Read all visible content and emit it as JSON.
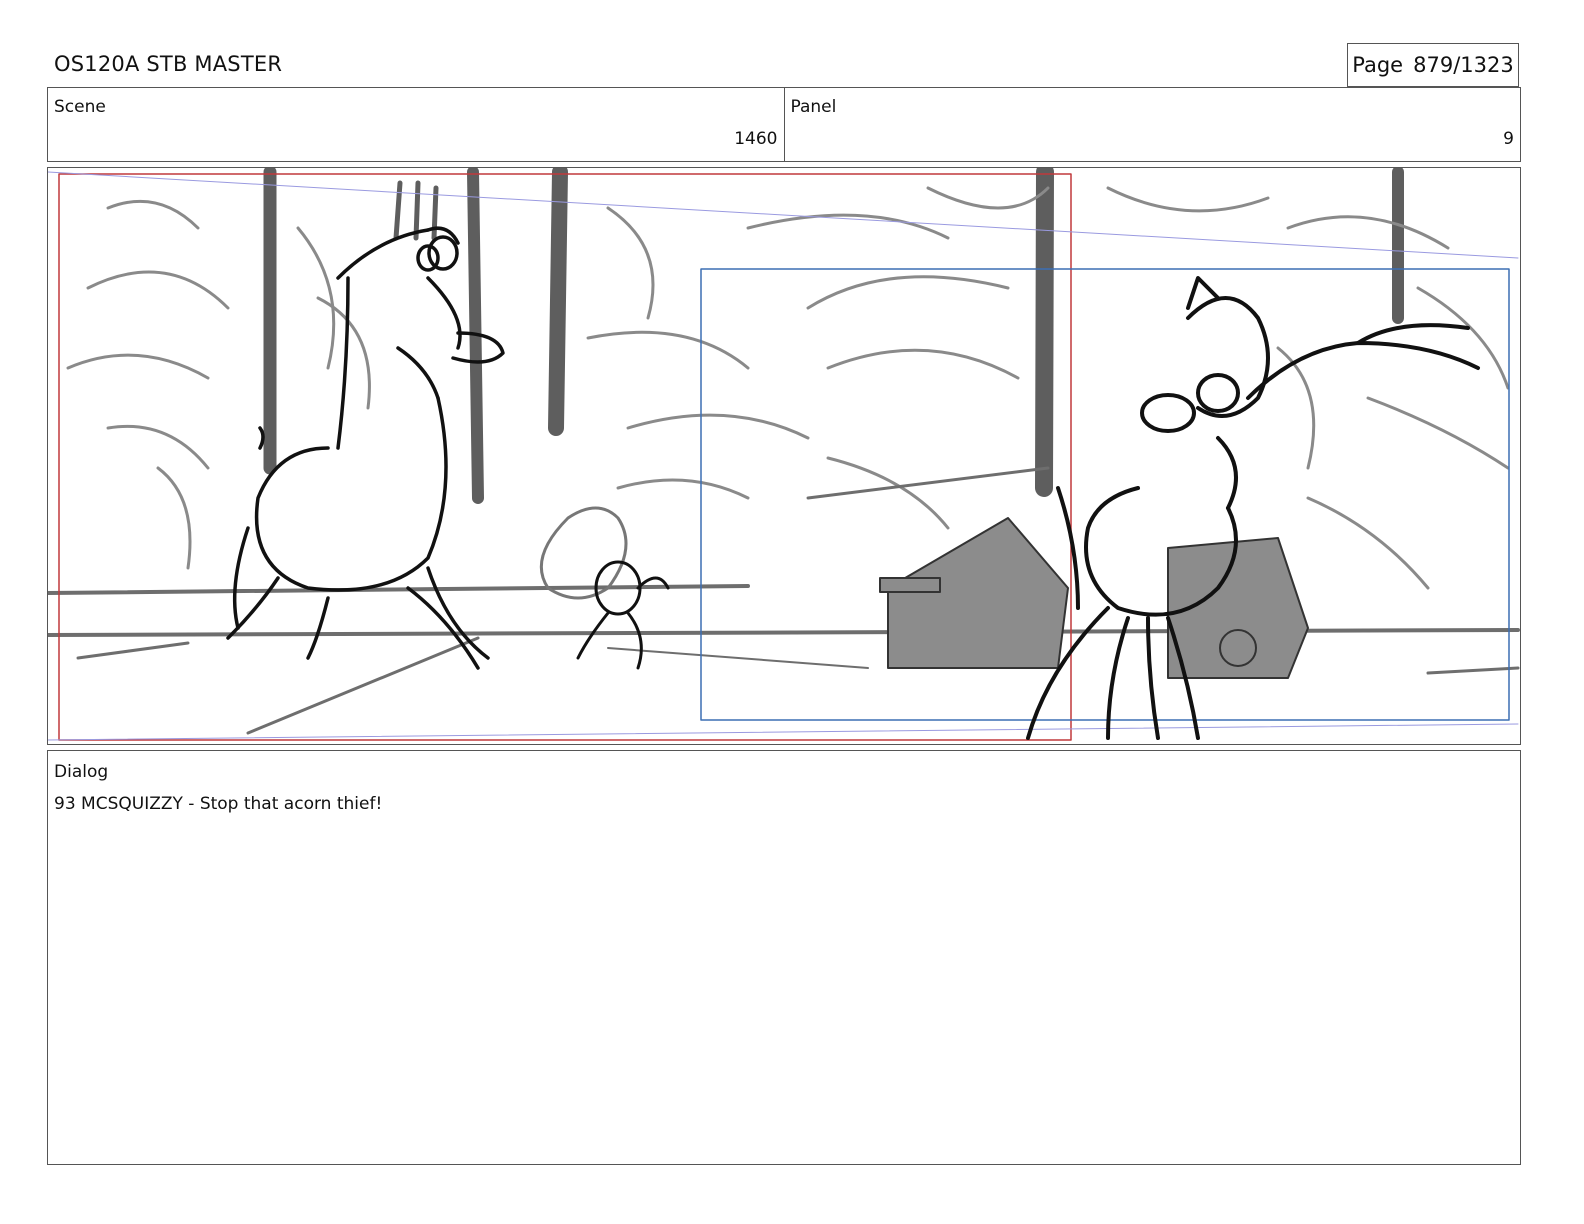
{
  "document": {
    "title": "OS120A STB MASTER",
    "page_label": "Page",
    "page_value": "879/1323"
  },
  "scene": {
    "label": "Scene",
    "value": "1460"
  },
  "panel": {
    "label": "Panel",
    "value": "9"
  },
  "dialog": {
    "label": "Dialog",
    "text": "93 MCSQUIZZY - Stop that acorn thief!"
  },
  "artwork": {
    "description_icon": "storyboard-sketch-image",
    "frame_colors": {
      "camera_start": "#c0393b",
      "camera_end": "#3c6fb4",
      "guide": "#9a9ae0"
    }
  }
}
